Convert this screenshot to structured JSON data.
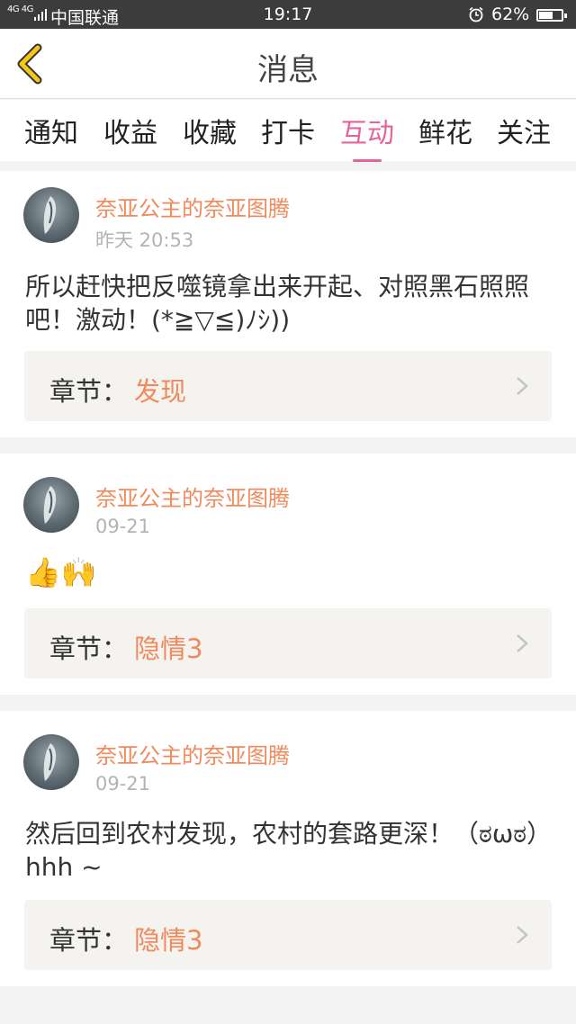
{
  "status_bar": {
    "network": "4G 4G",
    "carrier": "中国联通",
    "time": "19:17",
    "battery": "62%",
    "battery_level": 0.62
  },
  "header": {
    "title": "消息"
  },
  "tabs": [
    {
      "label": "通知",
      "active": false
    },
    {
      "label": "收益",
      "active": false
    },
    {
      "label": "收藏",
      "active": false
    },
    {
      "label": "打卡",
      "active": false
    },
    {
      "label": "互动",
      "active": true
    },
    {
      "label": "鲜花",
      "active": false
    },
    {
      "label": "关注",
      "active": false
    }
  ],
  "messages": [
    {
      "user": "奈亚公主的奈亚图腾",
      "time": "昨天 20:53",
      "content": "所以赶快把反噬镜拿出来开起、对照黑石照照吧！激动！(*≧▽≦)ﾉｼ))",
      "chapter_label": "章节：",
      "chapter_name": "发现"
    },
    {
      "user": "奈亚公主的奈亚图腾",
      "time": "09-21",
      "content": "👍🙌",
      "chapter_label": "章节：",
      "chapter_name": "隐情3"
    },
    {
      "user": "奈亚公主的奈亚图腾",
      "time": "09-21",
      "content": "然后回到农村发现，农村的套路更深！（ಠωಠ）hhh ~",
      "chapter_label": "章节：",
      "chapter_name": "隐情3"
    }
  ],
  "colors": {
    "accent": "#e6649a",
    "username": "#f08a5d",
    "back_arrow": "#f5c518"
  }
}
